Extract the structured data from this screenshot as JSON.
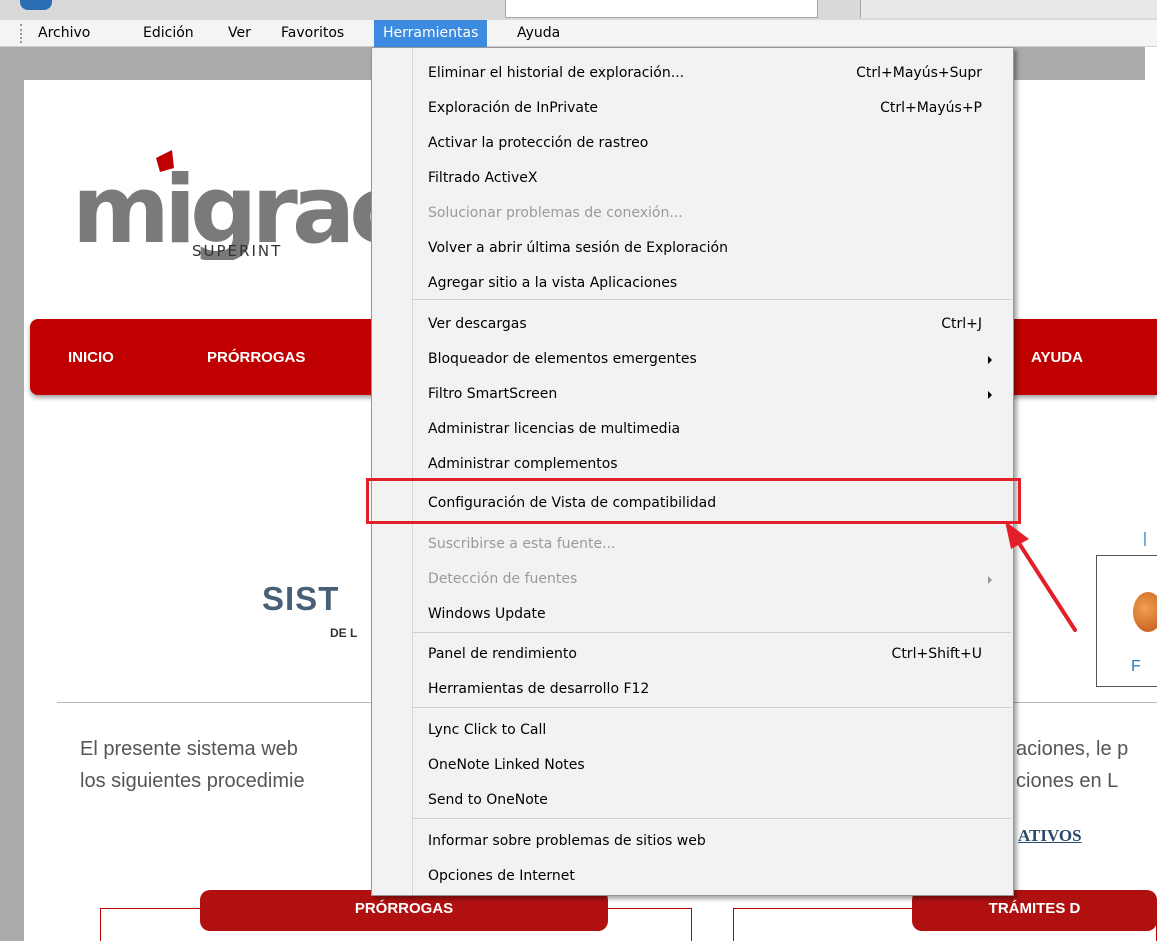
{
  "menubar": {
    "items": [
      "Archivo",
      "Edición",
      "Ver",
      "Favoritos",
      "Herramientas",
      "Ayuda"
    ],
    "active": "Herramientas"
  },
  "tools_menu": {
    "items": [
      {
        "label": "Eliminar el historial de exploración...",
        "shortcut": "Ctrl+Mayús+Supr"
      },
      {
        "label": "Exploración de InPrivate",
        "shortcut": "Ctrl+Mayús+P"
      },
      {
        "label": "Activar la protección de rastreo",
        "shortcut": ""
      },
      {
        "label": "Filtrado ActiveX",
        "shortcut": ""
      },
      {
        "label": "Solucionar problemas de conexión...",
        "shortcut": "",
        "disabled": true
      },
      {
        "label": "Volver a abrir última sesión de Exploración",
        "shortcut": ""
      },
      {
        "label": "Agregar sitio a la vista Aplicaciones",
        "shortcut": ""
      },
      {
        "label": "Ver descargas",
        "shortcut": "Ctrl+J"
      },
      {
        "label": "Bloqueador de elementos emergentes",
        "shortcut": "",
        "submenu": true
      },
      {
        "label": "Filtro SmartScreen",
        "shortcut": "",
        "submenu": true
      },
      {
        "label": "Administrar licencias de multimedia",
        "shortcut": ""
      },
      {
        "label": "Administrar complementos",
        "shortcut": ""
      },
      {
        "label": "Configuración de Vista de compatibilidad",
        "shortcut": "",
        "highlighted": true
      },
      {
        "label": "Suscribirse a esta fuente...",
        "shortcut": "",
        "disabled": true
      },
      {
        "label": "Detección de fuentes",
        "shortcut": "",
        "disabled": true,
        "submenu": true
      },
      {
        "label": "Windows Update",
        "shortcut": ""
      },
      {
        "label": "Panel de rendimiento",
        "shortcut": "Ctrl+Shift+U"
      },
      {
        "label": "Herramientas de desarrollo F12",
        "shortcut": ""
      },
      {
        "label": "Lync Click to Call",
        "shortcut": ""
      },
      {
        "label": "OneNote Linked Notes",
        "shortcut": ""
      },
      {
        "label": "Send to OneNote",
        "shortcut": ""
      },
      {
        "label": "Informar sobre problemas de sitios web",
        "shortcut": ""
      },
      {
        "label": "Opciones de Internet",
        "shortcut": ""
      }
    ]
  },
  "page": {
    "logo_text": "migrac",
    "logo_sub": "SUPERINT",
    "nav": [
      "INICIO",
      "PRÓRROGAS",
      "AYUDA"
    ],
    "title": "SIST",
    "subtitle": "DE L",
    "paragraph_left": [
      "El presente sistema web",
      "los siguientes procedimie"
    ],
    "paragraph_right": [
      "aciones, le p",
      "ciones en L"
    ],
    "informativos": "ATIVOS",
    "tabs": [
      "PRÓRROGAS",
      "TRÁMITES D"
    ],
    "side_label": "F"
  },
  "colors": {
    "brand_red": "#c00000",
    "menu_active": "#3d8be0",
    "annotation_red": "#e3202a"
  }
}
